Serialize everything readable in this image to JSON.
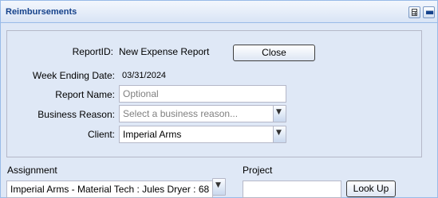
{
  "panel": {
    "title": "Reimbursements",
    "tools": [
      "calculator-icon",
      "collapse-icon"
    ]
  },
  "form": {
    "report_id": {
      "label": "ReportID:",
      "value": "New Expense Report"
    },
    "close_button": "Close",
    "week_ending": {
      "label": "Week Ending Date:",
      "value": "03/31/2024"
    },
    "report_name": {
      "label": "Report Name:",
      "placeholder": "Optional"
    },
    "business_reason": {
      "label": "Business Reason:",
      "placeholder": "Select a business reason..."
    },
    "client": {
      "label": "Client:",
      "value": "Imperial Arms"
    }
  },
  "assignment": {
    "label": "Assignment",
    "value": "Imperial Arms - Material Tech : Jules Dryer : 68"
  },
  "project": {
    "label": "Project",
    "value": "",
    "lookup_button": "Look Up"
  }
}
